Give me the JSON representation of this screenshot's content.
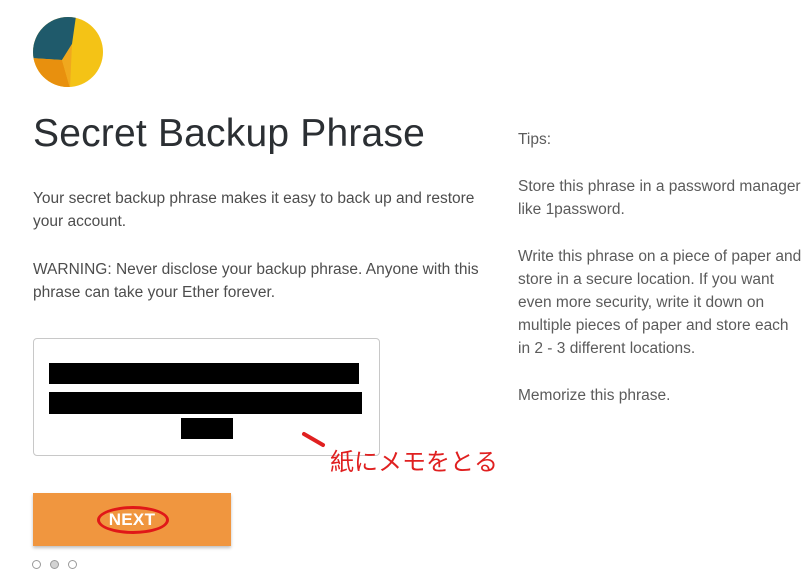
{
  "logo": {
    "icon": "metamask-fox-logo",
    "colors": [
      "#1f5a6b",
      "#f4c316",
      "#e8900e"
    ]
  },
  "page_title": "Secret Backup Phrase",
  "intro_text": "Your secret backup phrase makes it easy to back up and restore your account.",
  "warning_text": "WARNING: Never disclose your backup phrase. Anyone with this phrase can take your Ether forever.",
  "phrase_box": {
    "state": "redacted"
  },
  "annotation": {
    "text": "紙にメモをとる",
    "color": "#e02020"
  },
  "next_button": {
    "label": "NEXT",
    "color": "#f0963f"
  },
  "pager": {
    "total": 3,
    "active": 2
  },
  "tips": {
    "heading": "Tips:",
    "items": [
      "Store this phrase in a password manager like 1password.",
      "Write this phrase on a piece of paper and store in a secure location. If you want even more security, write it down on multiple pieces of paper and store each in 2 - 3 different locations.",
      "Memorize this phrase."
    ]
  }
}
